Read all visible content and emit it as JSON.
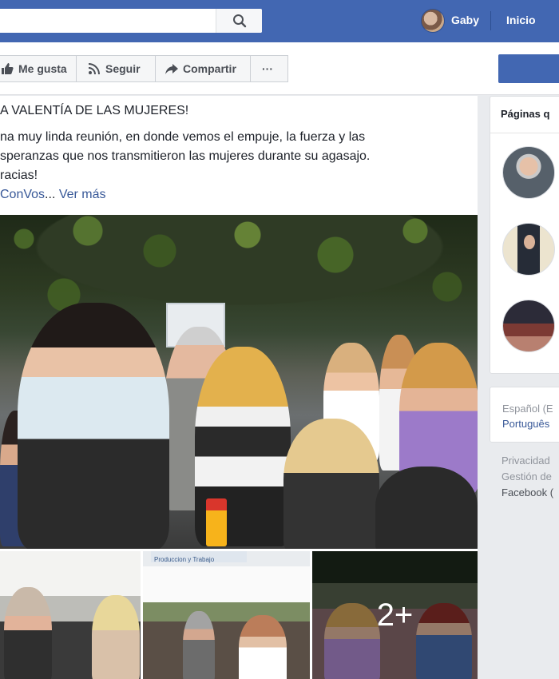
{
  "topbar": {
    "user_name": "Gaby",
    "home_label": "Inicio"
  },
  "actions": {
    "like": "Me gusta",
    "follow": "Seguir",
    "share": "Compartir",
    "more": "···"
  },
  "post": {
    "title": "A VALENTÍA DE LAS MUJERES!",
    "lines": [
      "na muy linda reunión, en donde vemos el empuje, la fuerza y las",
      "speranzas que nos transmitieron las mujeres durante su agasajo.",
      "racias!"
    ],
    "hashtag": "ConVos",
    "ellipsis": "...",
    "see_more": "Ver más",
    "photo_sign": "Produccion y Trabajo",
    "more_photos": "2+"
  },
  "sidebar": {
    "heading": "Páginas q",
    "lang_current": "Español (E",
    "lang_alt": "Português",
    "footer": [
      "Privacidad",
      "Gestión de",
      "Facebook ("
    ]
  },
  "colors": {
    "brand": "#4267b2",
    "link": "#385898"
  }
}
